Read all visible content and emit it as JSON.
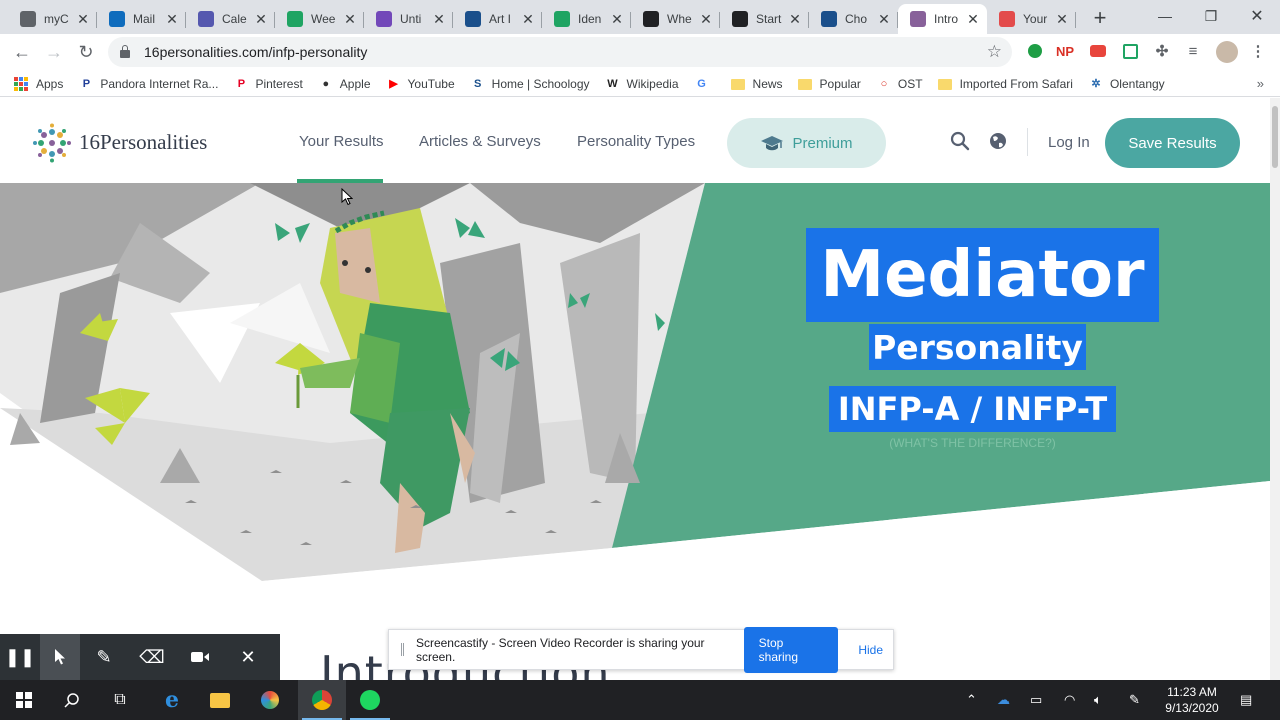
{
  "browser": {
    "tabs": [
      {
        "title": "myC",
        "icon": "target-icon",
        "color": "#5f6368"
      },
      {
        "title": "Mail",
        "icon": "outlook-icon",
        "color": "#0f6cbd"
      },
      {
        "title": "Cale",
        "icon": "teams-icon",
        "color": "#5558af"
      },
      {
        "title": "Wee",
        "icon": "drive-icon",
        "color": "#1fa463"
      },
      {
        "title": "Unti",
        "icon": "forms-icon",
        "color": "#7248b9"
      },
      {
        "title": "Art I",
        "icon": "schoology-icon",
        "color": "#1a4f8b"
      },
      {
        "title": "Iden",
        "icon": "drive-icon",
        "color": "#1fa463"
      },
      {
        "title": "Whe",
        "icon": "d-icon",
        "color": "#202124"
      },
      {
        "title": "Start",
        "icon": "d-icon",
        "color": "#202124"
      },
      {
        "title": "Cho",
        "icon": "schoology-icon",
        "color": "#1a4f8b"
      },
      {
        "title": "Intro",
        "icon": "16p-icon",
        "color": "#88619a"
      },
      {
        "title": "Your",
        "icon": "record-icon",
        "color": "#e34b4b"
      }
    ],
    "active_tab_index": 10,
    "address": "16personalities.com/infp-personality",
    "extensions": [
      "NP"
    ]
  },
  "bookmarks": [
    {
      "label": "Apps",
      "icon": "apps-icon"
    },
    {
      "label": "Pandora Internet Ra...",
      "icon": "pandora-icon",
      "glyph": "P"
    },
    {
      "label": "Pinterest",
      "icon": "pinterest-icon",
      "glyph": "P"
    },
    {
      "label": "Apple",
      "icon": "apple-icon",
      "glyph": "●"
    },
    {
      "label": "YouTube",
      "icon": "youtube-icon",
      "glyph": "▶"
    },
    {
      "label": "Home | Schoology",
      "icon": "schoology-icon",
      "glyph": "S"
    },
    {
      "label": "Wikipedia",
      "icon": "wikipedia-icon",
      "glyph": "W"
    },
    {
      "label": "",
      "icon": "google-icon",
      "glyph": "G"
    },
    {
      "label": "News",
      "icon": "folder-icon"
    },
    {
      "label": "Popular",
      "icon": "folder-icon"
    },
    {
      "label": "OST",
      "icon": "ost-icon",
      "glyph": "○"
    },
    {
      "label": "Imported From Safari",
      "icon": "folder-icon"
    },
    {
      "label": "Olentangy",
      "icon": "olentangy-icon",
      "glyph": "✲"
    }
  ],
  "site": {
    "logo_text": "16Personalities",
    "nav": {
      "your_results": "Your Results",
      "articles": "Articles & Surveys",
      "types": "Personality Types",
      "premium": "Premium"
    },
    "login": "Log In",
    "save_results": "Save Results",
    "brand_green": "#33a474",
    "brand_teal": "#4ba7a2"
  },
  "hero": {
    "title": "Mediator",
    "subtitle": "Personality",
    "type_code": "INFP-A / INFP-T",
    "difference_link": "(WHAT'S THE DIFFERENCE?)",
    "accent": "#56a888"
  },
  "content": {
    "heading": "Introduction"
  },
  "screencastify": {
    "message": "Screencastify - Screen Video Recorder is sharing your screen.",
    "stop": "Stop sharing",
    "hide": "Hide"
  },
  "taskbar": {
    "time": "11:23 AM",
    "date": "9/13/2020"
  }
}
